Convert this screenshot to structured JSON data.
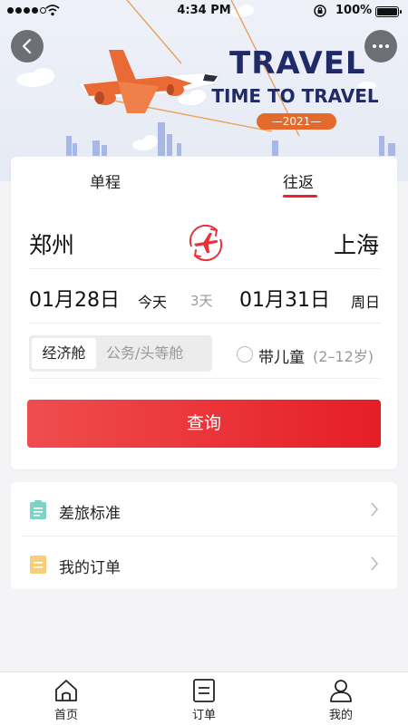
{
  "status_bar": {
    "time": "4:34 PM",
    "battery": "100%",
    "battery_level": 1.0
  },
  "hero": {
    "title": "TRAVEL",
    "subtitle": "TIME TO TRAVEL",
    "year": "—2021—"
  },
  "colors": {
    "accent": "#e51e25",
    "navy": "#1f2b69",
    "orange": "#e26a2c",
    "page_bg": "#f4f4f6"
  },
  "trip_tabs": [
    {
      "label": "单程",
      "active": false
    },
    {
      "label": "往返",
      "active": true
    }
  ],
  "route": {
    "from": "郑州",
    "to": "上海",
    "swap_icon": "plane-swap-icon"
  },
  "dates": {
    "depart": "01月28日",
    "depart_weekday": "今天",
    "duration": "3天",
    "return": "01月31日",
    "return_weekday": "周日"
  },
  "cabin": {
    "economy": "经济舱",
    "business": "公务/头等舱",
    "selected": "经济舱"
  },
  "child": {
    "label": "带儿童",
    "range": "(2–12岁)",
    "checked": false
  },
  "search_button": "查询",
  "menu": [
    {
      "label": "差旅标准",
      "icon": "travel-policy-icon",
      "color": "#7ed3c7"
    },
    {
      "label": "我的订单",
      "icon": "order-list-icon",
      "color": "#f7cf7a"
    }
  ],
  "tabbar": [
    {
      "label": "首页",
      "icon": "home-icon"
    },
    {
      "label": "订单",
      "icon": "orders-icon"
    },
    {
      "label": "我的",
      "icon": "profile-icon"
    }
  ]
}
